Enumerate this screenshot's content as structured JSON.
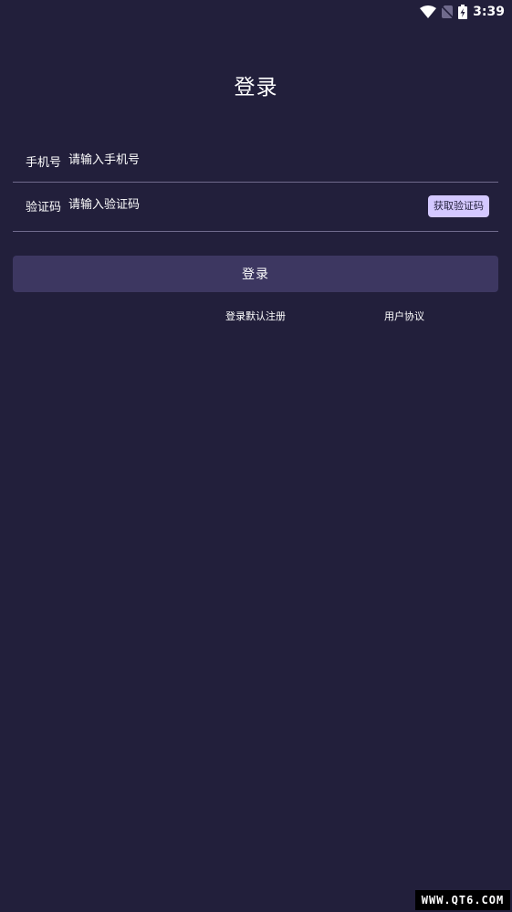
{
  "status_bar": {
    "time": "3:39",
    "icons": [
      "wifi-icon",
      "no-sim-icon",
      "battery-charging-icon"
    ]
  },
  "page": {
    "title": "登录"
  },
  "form": {
    "phone": {
      "label": "手机号",
      "placeholder": "请输入手机号",
      "value": ""
    },
    "code": {
      "label": "验证码",
      "placeholder": "请输入验证码",
      "value": "",
      "get_code_label": "获取验证码"
    }
  },
  "actions": {
    "login_label": "登录",
    "register_note": "登录默认注册",
    "agreement_link": "用户协议"
  },
  "watermark": {
    "text": "WWW.QT6.COM"
  },
  "colors": {
    "background": "#221f3b",
    "button": "#3d3761",
    "code_button": "#d4c8ff",
    "divider": "#6f6a8c"
  }
}
